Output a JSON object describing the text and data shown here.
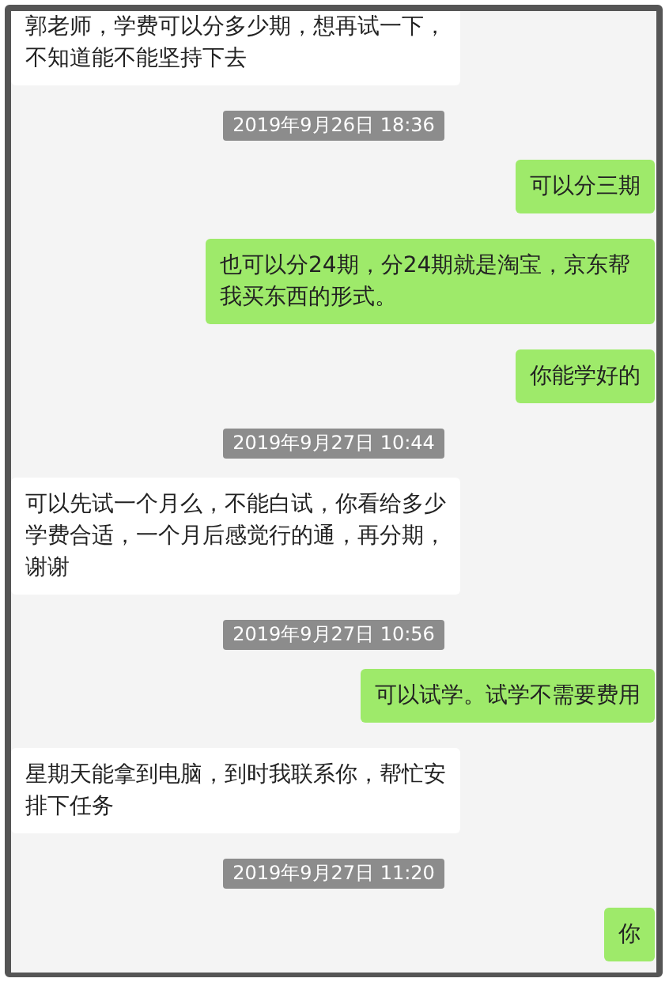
{
  "messages": [
    {
      "kind": "incoming",
      "text": "郭老师，学费可以分多少期，想再试一下，不知道能不能坚持下去"
    },
    {
      "kind": "time",
      "text": "2019年9月26日 18:36"
    },
    {
      "kind": "outgoing",
      "text": "可以分三期"
    },
    {
      "kind": "outgoing",
      "text": "也可以分24期，分24期就是淘宝，京东帮我买东西的形式。"
    },
    {
      "kind": "outgoing",
      "text": "你能学好的"
    },
    {
      "kind": "time",
      "text": "2019年9月27日 10:44"
    },
    {
      "kind": "incoming",
      "text": "可以先试一个月么，不能白试，你看给多少学费合适，一个月后感觉行的通，再分期，谢谢"
    },
    {
      "kind": "time",
      "text": "2019年9月27日 10:56"
    },
    {
      "kind": "outgoing",
      "text": "可以试学。试学不需要费用"
    },
    {
      "kind": "incoming",
      "text": "星期天能拿到电脑，到时我联系你，帮忙安排下任务"
    },
    {
      "kind": "time",
      "text": "2019年9月27日 11:20"
    },
    {
      "kind": "outgoing",
      "text": "你"
    }
  ]
}
